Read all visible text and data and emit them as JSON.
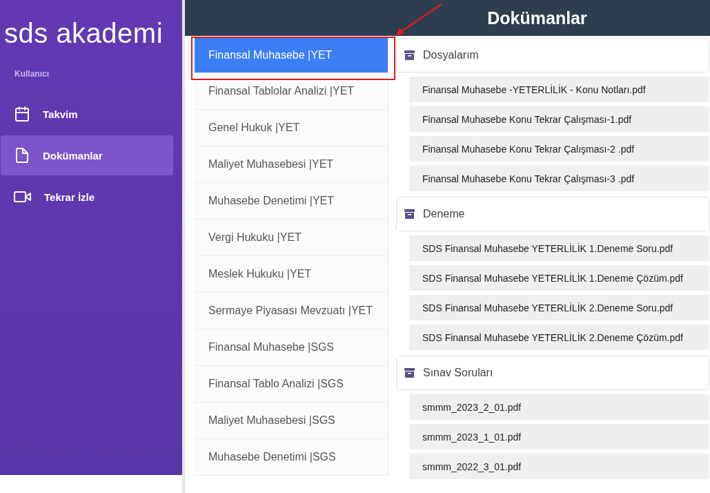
{
  "sidebar": {
    "logo": "sds akademi",
    "section_label": "Kullanıcı",
    "items": [
      {
        "label": "Takvim",
        "kind": "calendar",
        "selected": false
      },
      {
        "label": "Dokümanlar",
        "kind": "document",
        "selected": true
      },
      {
        "label": "Tekrar İzle",
        "kind": "video",
        "selected": false
      }
    ]
  },
  "header": {
    "title": "Dokümanlar"
  },
  "courses": [
    {
      "label": "Finansal Muhasebe |YET",
      "selected": true
    },
    {
      "label": "Finansal Tablolar Analizi |YET",
      "selected": false
    },
    {
      "label": "Genel Hukuk |YET",
      "selected": false
    },
    {
      "label": "Maliyet Muhasebesi |YET",
      "selected": false
    },
    {
      "label": "Muhasebe Denetimi |YET",
      "selected": false
    },
    {
      "label": "Vergi Hukuku |YET",
      "selected": false
    },
    {
      "label": "Meslek Hukuku |YET",
      "selected": false
    },
    {
      "label": "Sermaye Piyasası Mevzuatı |YET",
      "selected": false
    },
    {
      "label": "Finansal Muhasebe |SGS",
      "selected": false
    },
    {
      "label": "Finansal Tablo Analizi |SGS",
      "selected": false
    },
    {
      "label": "Maliyet Muhasebesi |SGS",
      "selected": false
    },
    {
      "label": "Muhasebe Denetimi |SGS",
      "selected": false
    }
  ],
  "folders": [
    {
      "title": "Dosyalarım",
      "files": [
        "Finansal Muhasebe -YETERLİLİK - Konu Notları.pdf",
        "Finansal Muhasebe Konu Tekrar Çalışması-1.pdf",
        "Finansal Muhasebe Konu Tekrar Çalışması-2 .pdf",
        "Finansal Muhasebe Konu Tekrar Çalışması-3 .pdf"
      ]
    },
    {
      "title": "Deneme",
      "files": [
        "SDS Finansal Muhasebe YETERLİLİK 1.Deneme Soru.pdf",
        "SDS Finansal Muhasebe YETERLİLİK 1.Deneme Çözüm.pdf",
        "SDS Finansal Muhasebe YETERLİLİK 2.Deneme Soru.pdf",
        "SDS Finansal Muhasebe YETERLİLİK 2.Deneme Çözüm.pdf"
      ]
    },
    {
      "title": "Sınav Soruları",
      "files": [
        "smmm_2023_2_01.pdf",
        "smmm_2023_1_01.pdf",
        "smmm_2022_3_01.pdf"
      ]
    }
  ]
}
